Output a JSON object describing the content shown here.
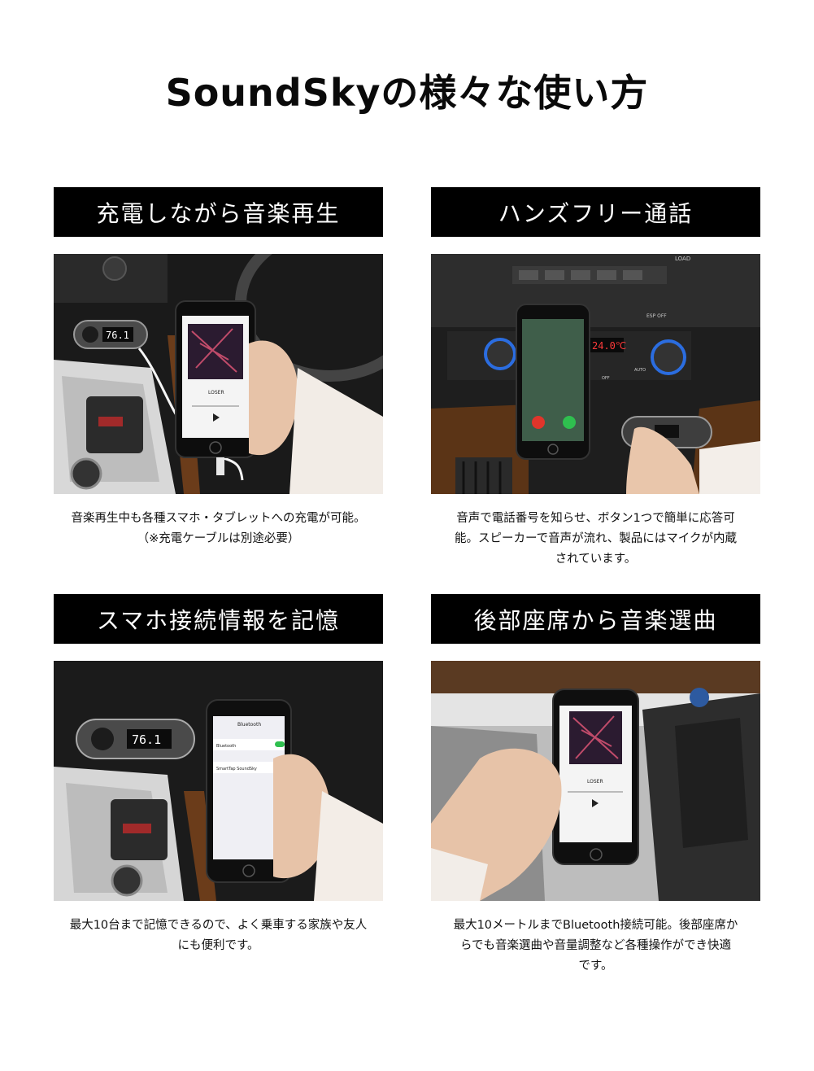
{
  "page_title": "SoundSkyの様々な使い方",
  "cards": [
    {
      "heading": "充電しながら音楽再生",
      "description_lines": [
        "音楽再生中も各種スマホ・タブレットへの充電が可能。",
        "（※充電ケーブルは別途必要）"
      ],
      "device_display": "76.1",
      "song": "LOSER"
    },
    {
      "heading": "ハンズフリー通話",
      "description_lines": [
        "音声で電話番号を知らせ、ボタン1つで簡単に応答可",
        "能。スピーカーで音声が流れ、製品にはマイクが内蔵",
        "されています。"
      ],
      "climate_display": "24.0℃",
      "panel_labels": [
        "LOAD",
        "ESP OFF",
        "AUTO",
        "OFF"
      ]
    },
    {
      "heading": "スマホ接続情報を記憶",
      "description_lines": [
        "最大10台まで記憶できるので、よく乗車する家族や友人",
        "にも便利です。"
      ],
      "device_display": "76.1",
      "phone_screen_title": "Bluetooth",
      "phone_rows": [
        "Bluetooth",
        "SmartTap SoundSky"
      ]
    },
    {
      "heading": "後部座席から音楽選曲",
      "description_lines": [
        "最大10メートルまでBluetooth接続可能。後部座席か",
        "らでも音楽選曲や音量調整など各種操作ができ快適",
        "です。"
      ],
      "song": "LOSER"
    }
  ],
  "colors": {
    "header_bg": "#000000",
    "header_text": "#ffffff",
    "accept_green": "#2fbf4f",
    "decline_red": "#e0352b"
  }
}
